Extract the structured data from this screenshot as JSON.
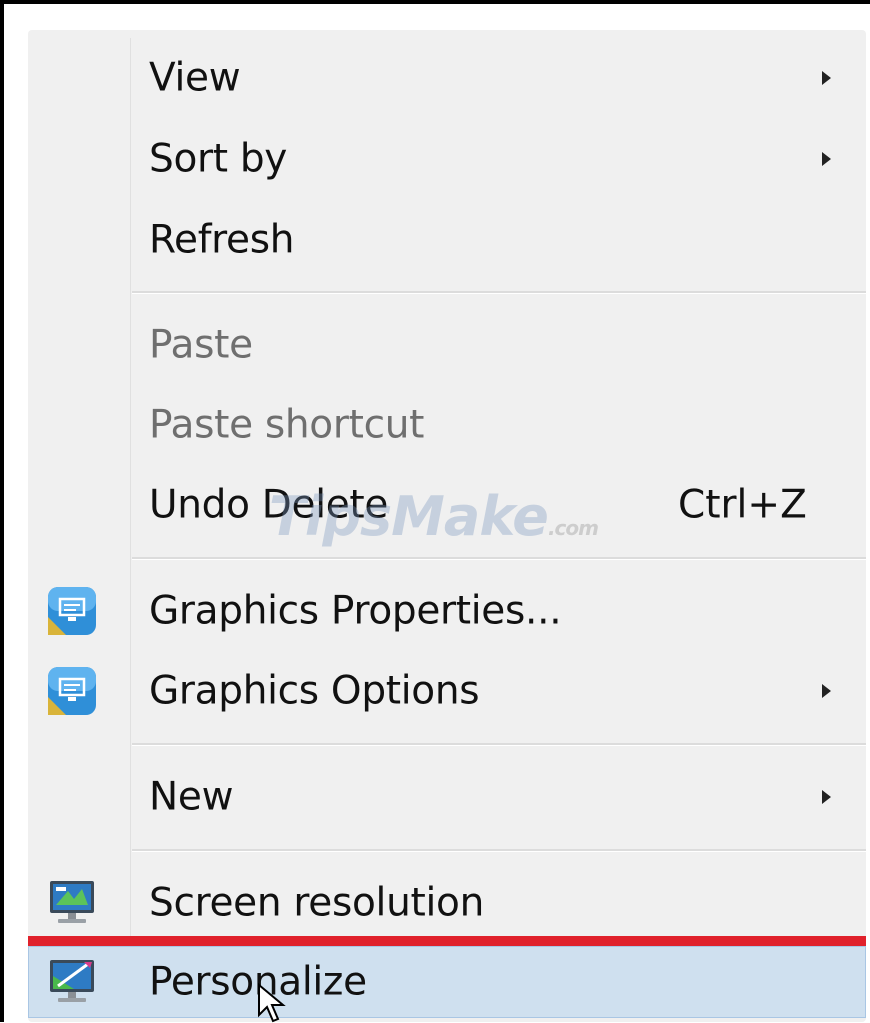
{
  "menu": {
    "items": [
      {
        "label": "View",
        "has_submenu": true,
        "enabled": true
      },
      {
        "label": "Sort by",
        "has_submenu": true,
        "enabled": true
      },
      {
        "label": "Refresh",
        "has_submenu": false,
        "enabled": true
      },
      {
        "label": "Paste",
        "has_submenu": false,
        "enabled": false
      },
      {
        "label": "Paste shortcut",
        "has_submenu": false,
        "enabled": false
      },
      {
        "label": "Undo Delete",
        "shortcut": "Ctrl+Z",
        "has_submenu": false,
        "enabled": true
      },
      {
        "label": "Graphics Properties...",
        "icon": "intel-graphics-icon",
        "has_submenu": false,
        "enabled": true
      },
      {
        "label": "Graphics Options",
        "icon": "intel-graphics-icon",
        "has_submenu": true,
        "enabled": true
      },
      {
        "label": "New",
        "has_submenu": true,
        "enabled": true
      },
      {
        "label": "Screen resolution",
        "icon": "monitor-icon",
        "has_submenu": false,
        "enabled": true
      },
      {
        "label": "Personalize",
        "icon": "personalize-monitor-icon",
        "has_submenu": false,
        "enabled": true,
        "highlighted": true
      }
    ]
  },
  "watermark": {
    "text": "TipsMake",
    "suffix": ".com"
  },
  "colors": {
    "menu_bg": "#f0f0f0",
    "highlight_bg": "#cfe0ef",
    "highlight_marker": "#e0212b",
    "disabled_text": "#6f6f6f"
  }
}
